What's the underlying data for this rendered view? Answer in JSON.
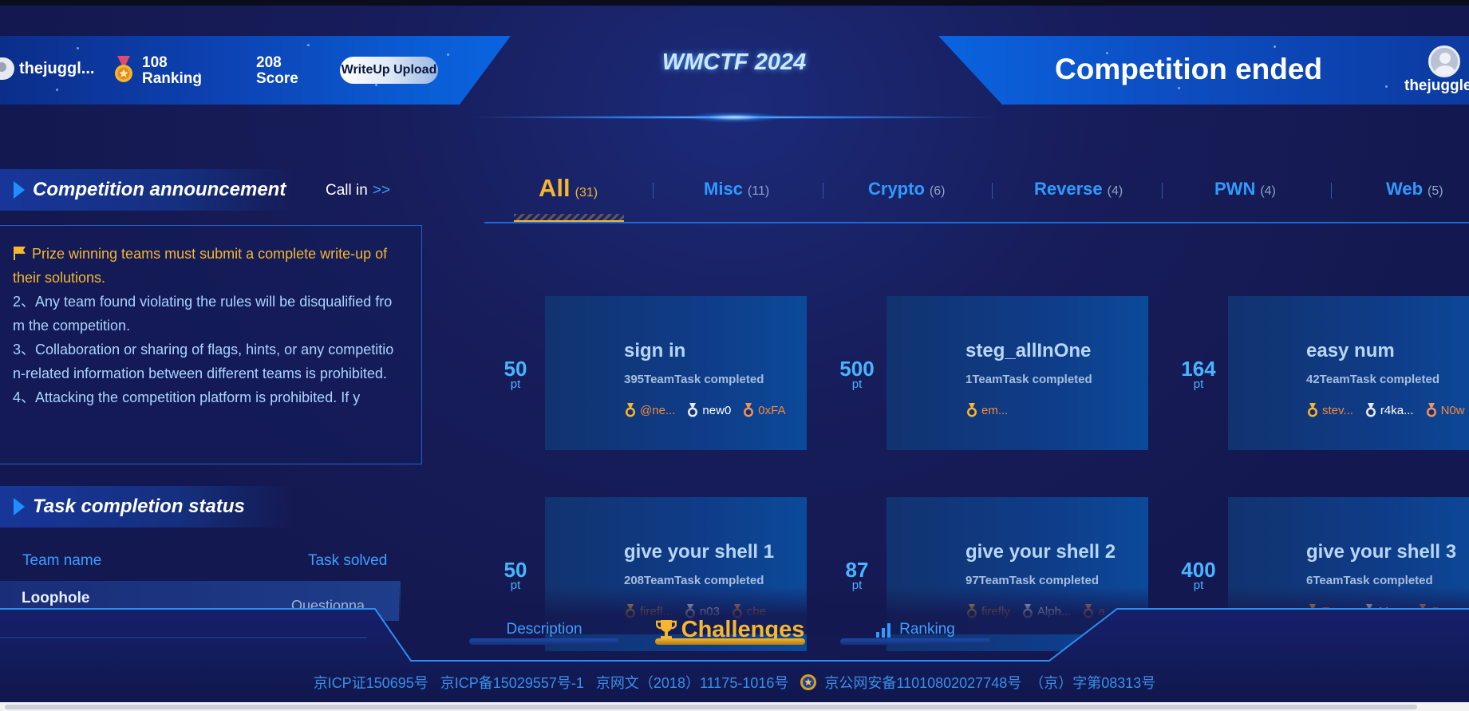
{
  "header": {
    "title": "WMCTF 2024",
    "user_name_left": "thejuggl...",
    "ranking_value": "108",
    "ranking_label": "Ranking",
    "score_value": "208",
    "score_label": "Score",
    "writeup_button": "WriteUp Upload",
    "status": "Competition ended",
    "user_name_right": "thejuggle"
  },
  "announcement": {
    "title": "Competition announcement",
    "call_in": "Call in",
    "call_in_arrow": ">>",
    "items": [
      "Prize winning teams must submit a complete write-up of their solutions.",
      "2、Any team found violating the rules will be disqualified from the competition.",
      "3、Collaboration or sharing of flags, hints, or any competition-related information between different teams is prohibited.",
      "4、Attacking the competition platform is prohibited. If y"
    ]
  },
  "task_status": {
    "title": "Task completion status",
    "col_team": "Team name",
    "col_solved": "Task solved",
    "rows": [
      {
        "team": "Loophole",
        "task": "Questionna..."
      }
    ]
  },
  "tabs": [
    {
      "label": "All",
      "count": "(31)"
    },
    {
      "label": "Misc",
      "count": "(11)"
    },
    {
      "label": "Crypto",
      "count": "(6)"
    },
    {
      "label": "Reverse",
      "count": "(4)"
    },
    {
      "label": "PWN",
      "count": "(4)"
    },
    {
      "label": "Web",
      "count": "(5)"
    }
  ],
  "pt_unit": "pt",
  "challenges": [
    {
      "points": "50",
      "name": "sign in",
      "completed": "395TeamTask completed",
      "solvers": [
        {
          "name": "@ne...",
          "tier": "gold"
        },
        {
          "name": "new0",
          "tier": "silver"
        },
        {
          "name": "0xFA",
          "tier": "bronze"
        }
      ]
    },
    {
      "points": "500",
      "name": "steg_allInOne",
      "completed": "1TeamTask completed",
      "solvers": [
        {
          "name": "em...",
          "tier": "gold"
        }
      ]
    },
    {
      "points": "164",
      "name": "easy num",
      "completed": "42TeamTask completed",
      "solvers": [
        {
          "name": "stev...",
          "tier": "gold"
        },
        {
          "name": "r4ka...",
          "tier": "silver"
        },
        {
          "name": "N0w",
          "tier": "bronze"
        }
      ]
    },
    {
      "points": "50",
      "name": "give your shell 1",
      "completed": "208TeamTask completed",
      "solvers": [
        {
          "name": "firefl...",
          "tier": "gold"
        },
        {
          "name": "n03",
          "tier": "silver"
        },
        {
          "name": "che",
          "tier": "bronze"
        }
      ]
    },
    {
      "points": "87",
      "name": "give your shell 2",
      "completed": "97TeamTask completed",
      "solvers": [
        {
          "name": "firefly",
          "tier": "gold"
        },
        {
          "name": "Alph...",
          "tier": "silver"
        },
        {
          "name": "a",
          "tier": "bronze"
        }
      ]
    },
    {
      "points": "400",
      "name": "give your shell 3",
      "completed": "6TeamTask completed",
      "solvers": [
        {
          "name": "Tea...",
          "tier": "gold"
        },
        {
          "name": "Mo...",
          "tier": "silver"
        },
        {
          "name": "B",
          "tier": "bronze"
        }
      ]
    }
  ],
  "bottom_nav": {
    "description": "Description",
    "challenges": "Challenges",
    "ranking": "Ranking"
  },
  "footer": {
    "icp_license": "京ICP证150695号",
    "icp_record": "京ICP备15029557号-1",
    "net_culture": "京网文（2018）11175-1016号",
    "police_record": "京公网安备11010802027748号",
    "broadcast": "（京）字第08313号"
  },
  "colors": {
    "accent_gold": "#f5b630",
    "accent_blue": "#2f9bff",
    "background": "#14184f"
  }
}
